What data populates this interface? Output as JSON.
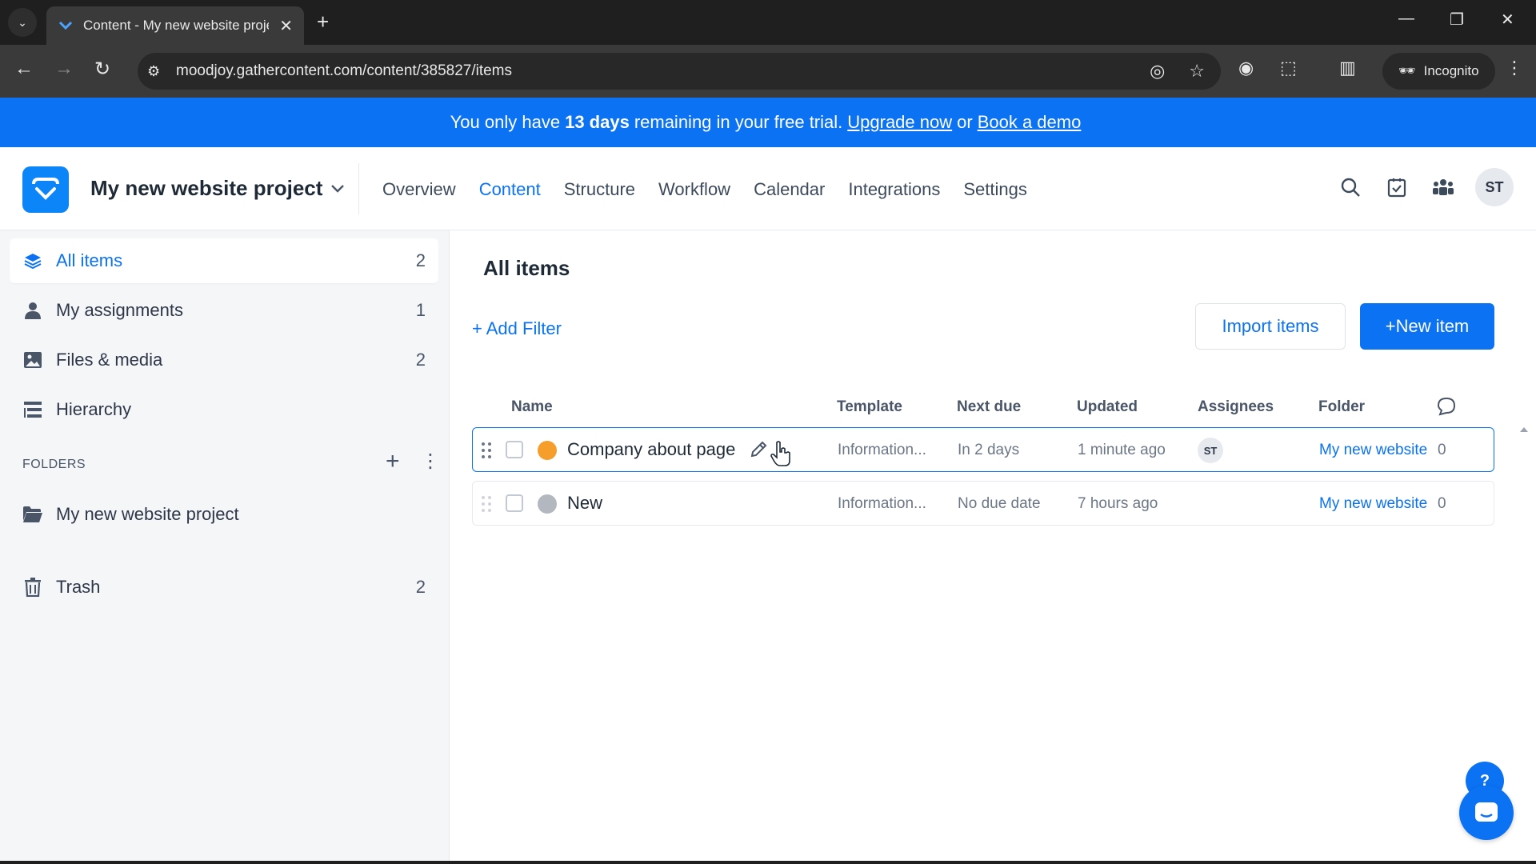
{
  "browser": {
    "tab_title": "Content - My new website project",
    "url": "moodjoy.gathercontent.com/content/385827/items",
    "incognito_label": "Incognito"
  },
  "banner": {
    "prefix": "You only have",
    "days": "13 days",
    "middle": "remaining in your free trial.",
    "upgrade_link": "Upgrade now",
    "or": "or",
    "demo_link": "Book a demo"
  },
  "header": {
    "project_name": "My new website project",
    "nav": [
      "Overview",
      "Content",
      "Structure",
      "Workflow",
      "Calendar",
      "Integrations",
      "Settings"
    ],
    "active_nav": "Content",
    "avatar_initials": "ST"
  },
  "sidebar": {
    "items": [
      {
        "label": "All items",
        "count": "2"
      },
      {
        "label": "My assignments",
        "count": "1"
      },
      {
        "label": "Files & media",
        "count": "2"
      },
      {
        "label": "Hierarchy",
        "count": ""
      }
    ],
    "folders_label": "FOLDERS",
    "folders": [
      {
        "label": "My new website project"
      }
    ],
    "trash": {
      "label": "Trash",
      "count": "2"
    }
  },
  "main": {
    "title": "All items",
    "add_filter": "+ Add Filter",
    "import_button": "Import items",
    "new_button": "+New item",
    "columns": [
      "Name",
      "Template",
      "Next due",
      "Updated",
      "Assignees",
      "Folder"
    ],
    "rows": [
      {
        "name": "Company about page",
        "status_color": "#f59e2b",
        "template": "Information...",
        "next_due": "In 2 days",
        "updated": "1 minute ago",
        "assignee": "ST",
        "folder": "My new website project",
        "comments": "0"
      },
      {
        "name": "New",
        "status_color": "#b3b8c0",
        "template": "Information...",
        "next_due": "No due date",
        "updated": "7 hours ago",
        "assignee": "",
        "folder": "My new website project",
        "comments": "0"
      }
    ]
  },
  "colors": {
    "accent": "#0b72f3",
    "banner": "#0b72f3",
    "chrome_dark": "#1f1f1f"
  }
}
